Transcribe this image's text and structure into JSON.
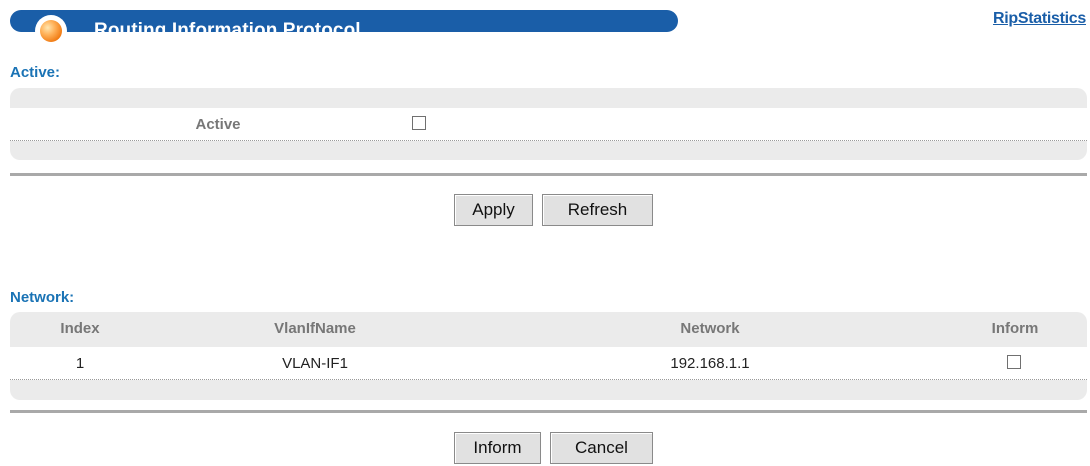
{
  "header": {
    "title": "Routing Information Protocol",
    "link": "RipStatistics"
  },
  "active_section": {
    "label": "Active:",
    "field_label": "Active",
    "checked": false
  },
  "active_buttons": {
    "apply": "Apply",
    "refresh": "Refresh"
  },
  "network_section": {
    "label": "Network:",
    "columns": [
      "Index",
      "VlanIfName",
      "Network",
      "Inform"
    ],
    "rows": [
      {
        "index": "1",
        "vlan_if_name": "VLAN-IF1",
        "network": "192.168.1.1",
        "inform": false
      }
    ]
  },
  "network_buttons": {
    "inform": "Inform",
    "cancel": "Cancel"
  },
  "colors": {
    "accent": "#1a5ea8",
    "section_label": "#1a73b5",
    "panel": "#ebebeb"
  }
}
